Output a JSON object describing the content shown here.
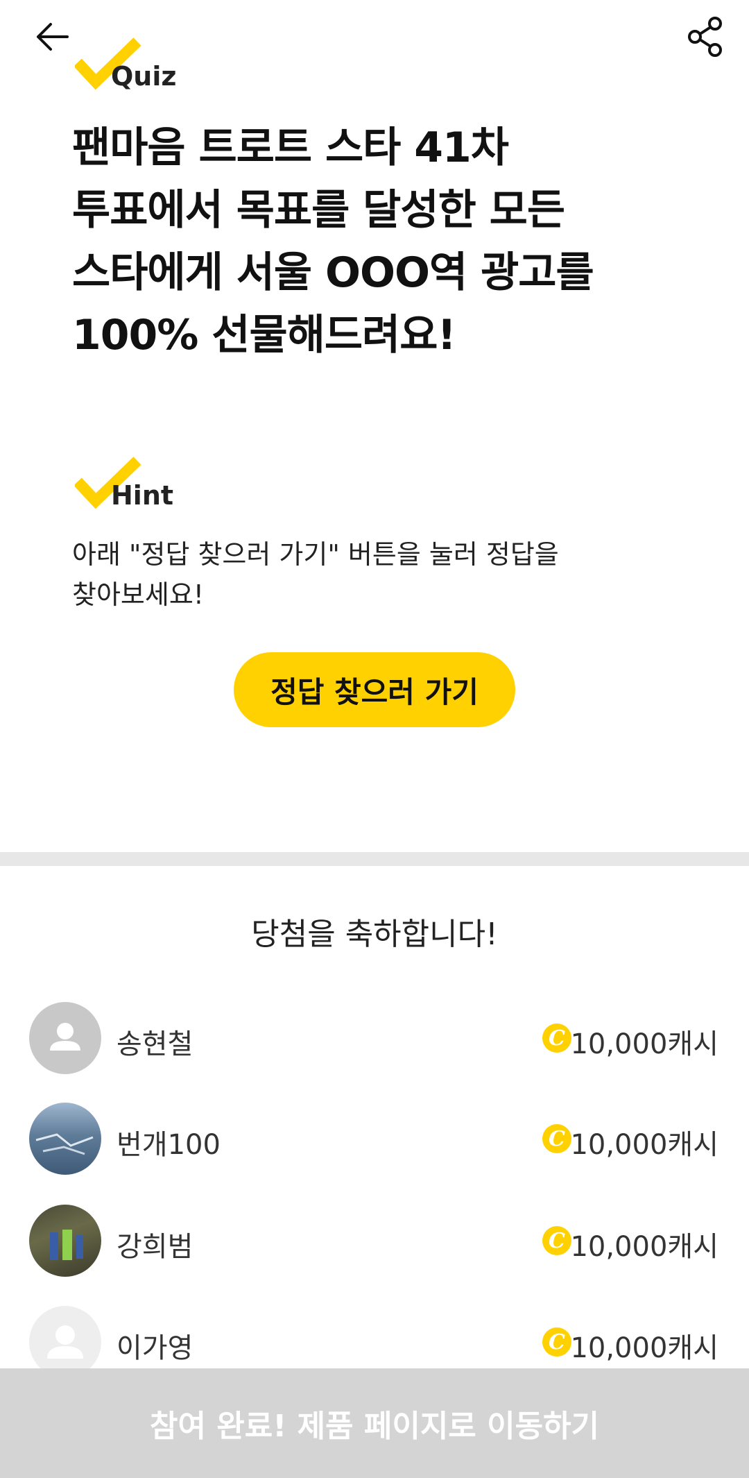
{
  "quiz_badge": {
    "label": "Quiz"
  },
  "question": "팬마음 트로트 스타 41차\n투표에서 목표를 달성한 모든\n스타에게 서울 OOO역 광고를\n100% 선물해드려요!",
  "hint_badge": {
    "label": "Hint"
  },
  "hint_text": "아래 \"정답 찾으러 가기\" 버튼을 눌러 정답을\n찾아보세요!",
  "find_answer_button": "정답 찾으러 가기",
  "winners": {
    "title": "당첨을 축하합니다!",
    "coin_symbol": "C",
    "list": [
      {
        "name": "송현철",
        "amount": "10,000캐시",
        "avatar": "default-avatar"
      },
      {
        "name": "번개100",
        "amount": "10,000캐시",
        "avatar": "photo-avatar"
      },
      {
        "name": "강희범",
        "amount": "10,000캐시",
        "avatar": "photo-avatar"
      },
      {
        "name": "이가영",
        "amount": "10,000캐시",
        "avatar": "default-avatar"
      }
    ]
  },
  "bottom_button": "참여 완료! 제품 페이지로 이동하기",
  "colors": {
    "accent": "#ffd100",
    "divider": "#e7e7e7",
    "bottom_bar": "#d4d4d4"
  },
  "icons": {
    "back": "arrow-left-icon",
    "share": "share-icon",
    "check": "check-mark-icon",
    "coin": "coin-icon",
    "avatar": "person-icon"
  }
}
